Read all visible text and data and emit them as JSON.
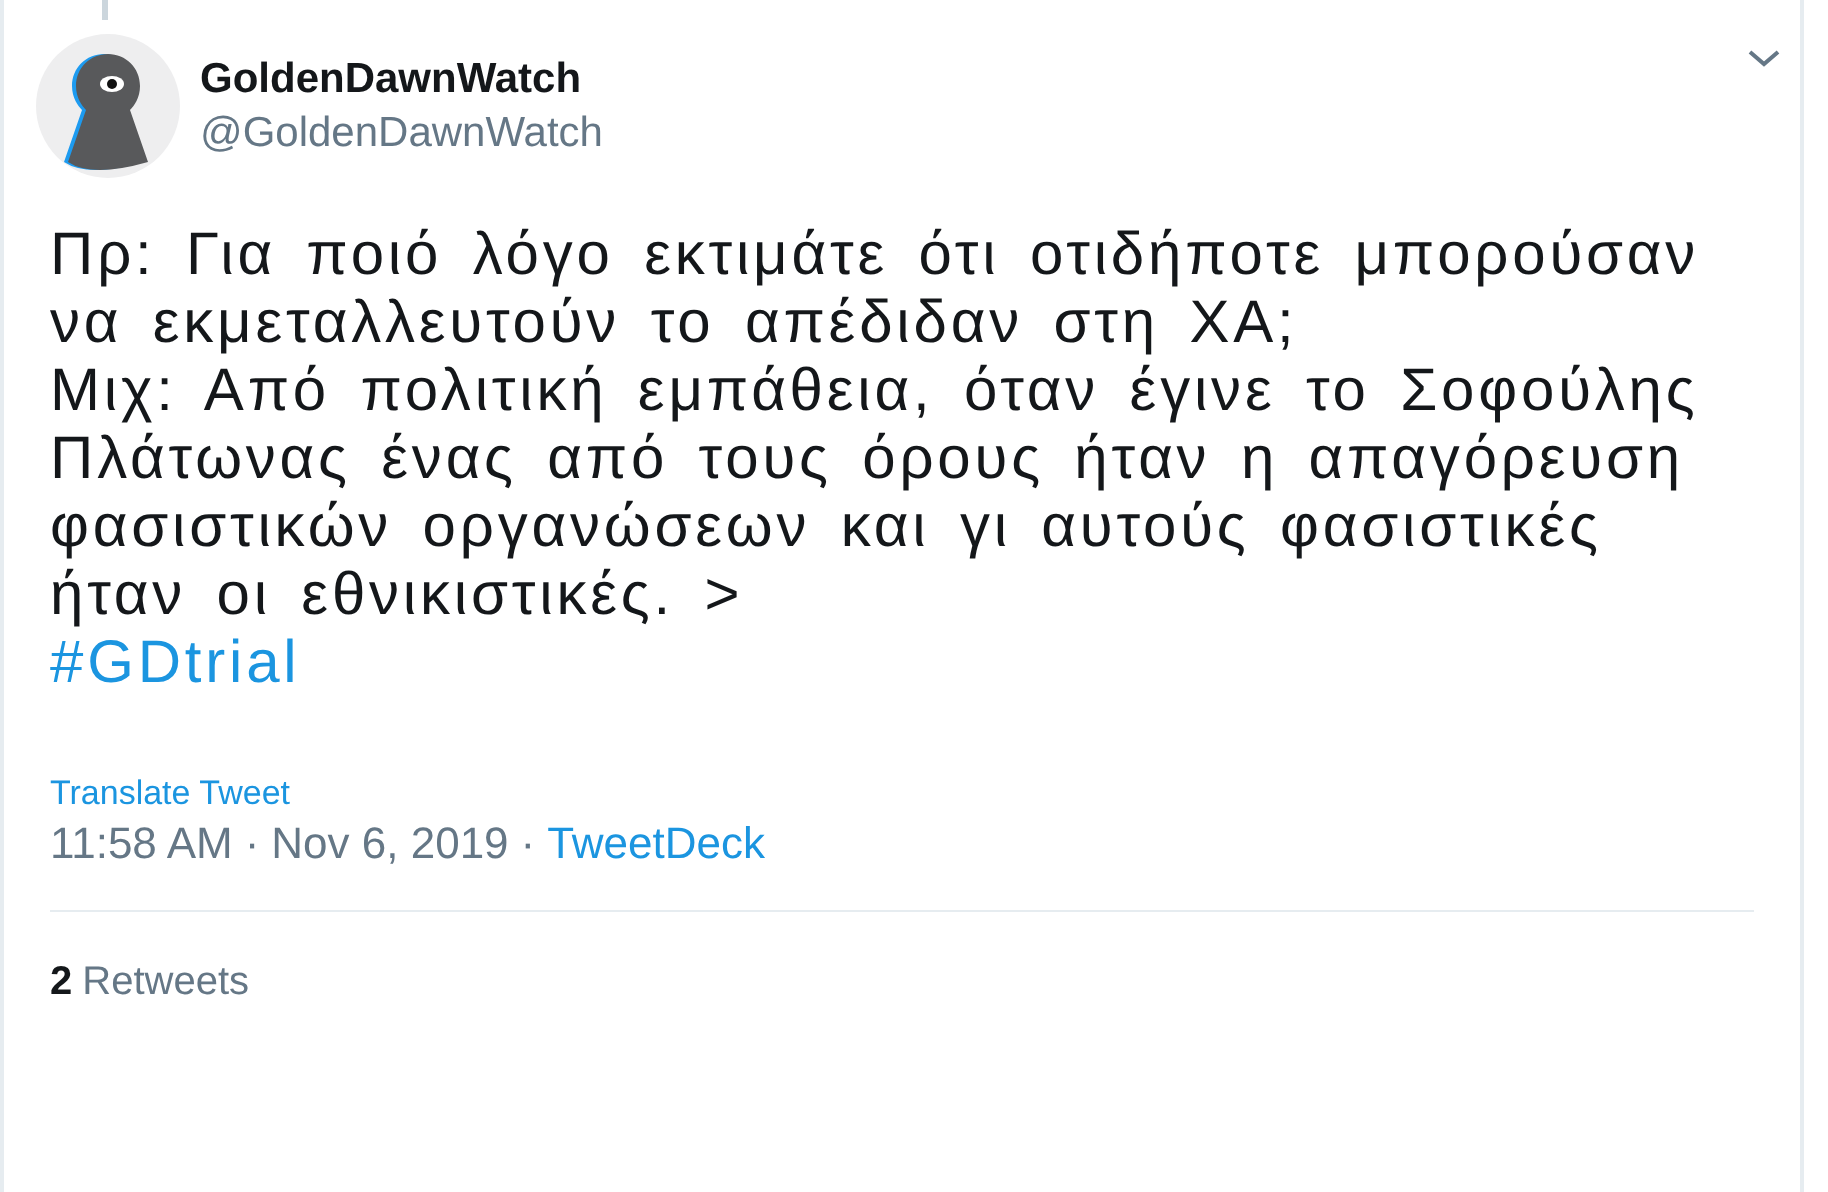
{
  "author": {
    "name": "GoldenDawnWatch",
    "handle": "@GoldenDawnWatch"
  },
  "body": {
    "paragraphs": [
      "Πρ: Για ποιό λόγο εκτιμάτε ότι οτιδήποτε μπορούσαν να εκμεταλλευτούν το απέδιδαν στη ΧΑ;",
      "Μιχ: Από πολιτική εμπάθεια, όταν έγινε το Σοφούλης Πλάτωνας ένας από τους όρους ήταν η απαγόρευση φασιστικών οργανώσεων και γι αυτούς φασιστικές ήταν οι εθνικιστικές. >"
    ],
    "hashtag": "#GDtrial"
  },
  "translate": "Translate Tweet",
  "meta": [
    {
      "kind": "time",
      "text": "11:58 AM"
    },
    {
      "kind": "separator",
      "text": "·"
    },
    {
      "kind": "date",
      "text": "Nov 6, 2019"
    },
    {
      "kind": "separator",
      "text": "·"
    },
    {
      "kind": "source",
      "text": "TweetDeck"
    }
  ],
  "stats": {
    "count": "2",
    "label": "Retweets"
  }
}
